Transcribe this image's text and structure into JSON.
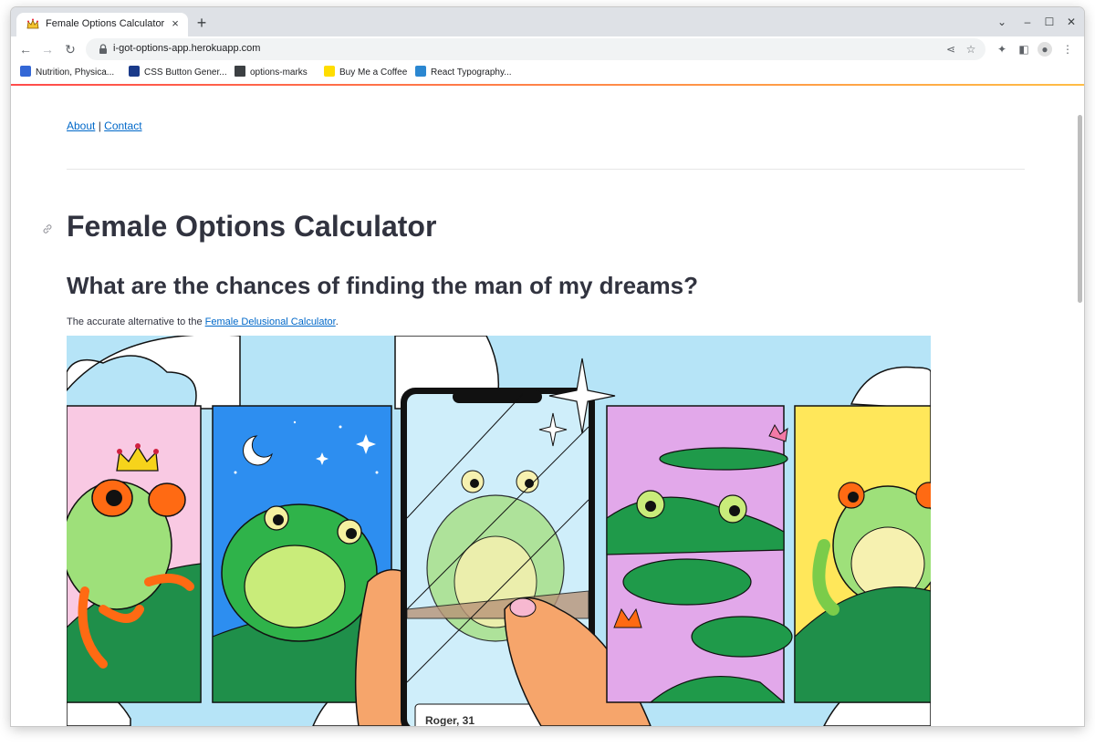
{
  "browser": {
    "tab_title": "Female Options Calculator",
    "tab_close": "×",
    "new_tab": "+",
    "url": "i-got-options-app.herokuapp.com",
    "window_controls": [
      "⌄",
      "–",
      "☐",
      "✕"
    ]
  },
  "bookmarks": [
    {
      "label": "Nutrition, Physica...",
      "icon": "nutrition-icon",
      "color": "#3367d6"
    },
    {
      "label": "CSS Button Gener...",
      "icon": "x-icon",
      "color": "#1a3a8a"
    },
    {
      "label": "options-marks",
      "icon": "folder-icon",
      "color": "#3c4043"
    },
    {
      "label": "Buy Me a Coffee",
      "icon": "coffee-icon",
      "color": "#ffdd00"
    },
    {
      "label": "React Typography...",
      "icon": "react-typography-icon",
      "color": "#2b87d1"
    }
  ],
  "nav": {
    "about": "About",
    "separator": "|",
    "contact": "Contact"
  },
  "page": {
    "title": "Female Options Calculator",
    "subtitle": "What are the chances of finding the man of my dreams?",
    "intro_prefix": "The accurate alternative to the ",
    "intro_link": "Female Delusional Calculator",
    "intro_suffix": "."
  },
  "hero": {
    "profile_caption": "Roger, 31"
  },
  "colors": {
    "accent_start": "#ff4b4b",
    "accent_end": "#ffbd45",
    "link": "#0068c9",
    "text": "#31333f"
  }
}
